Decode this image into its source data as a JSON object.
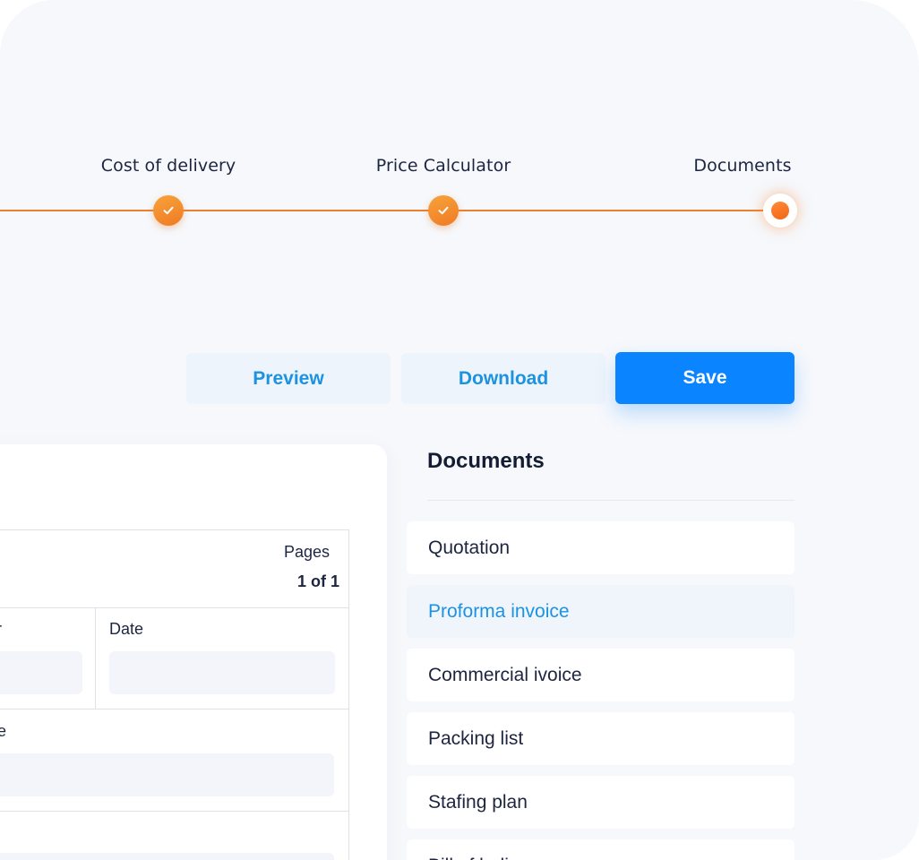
{
  "stepper": {
    "steps": [
      {
        "label": "Cost of delivery",
        "status": "completed"
      },
      {
        "label": "Price Calculator",
        "status": "completed"
      },
      {
        "label": "Documents",
        "status": "current"
      }
    ],
    "accent_color": "#ee7f2c"
  },
  "actions": {
    "preview_label": "Preview",
    "download_label": "Download",
    "save_label": "Save",
    "primary_color": "#0a84ff"
  },
  "form": {
    "pages_label": "Pages",
    "pages_value": "1 of 1",
    "partial_label_1": "r",
    "date_label": "Date",
    "partial_label_2": "e"
  },
  "documents_panel": {
    "title": "Documents",
    "items": [
      {
        "label": "Quotation",
        "active": false
      },
      {
        "label": "Proforma invoice",
        "active": true
      },
      {
        "label": "Commercial ivoice",
        "active": false
      },
      {
        "label": "Packing list",
        "active": false
      },
      {
        "label": "Stafing plan",
        "active": false
      },
      {
        "label": "Bill of lading",
        "active": false
      }
    ]
  }
}
